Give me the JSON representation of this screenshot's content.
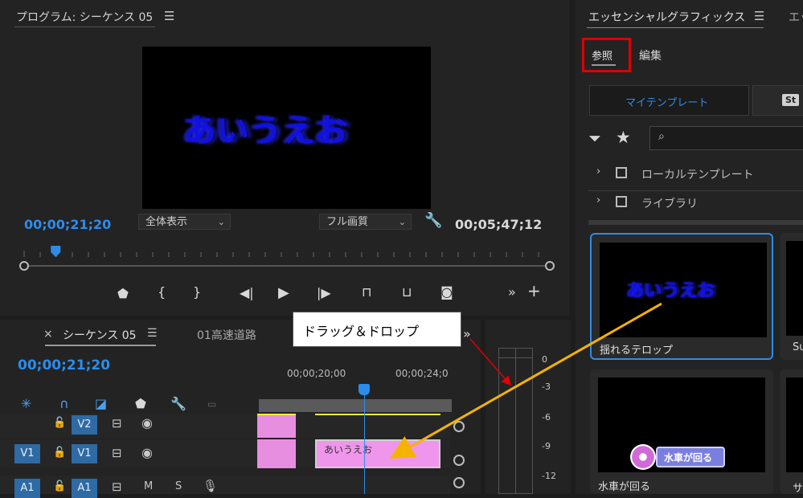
{
  "program_monitor": {
    "title": "プログラム: シーケンス 05",
    "preview_text": "あいうえお",
    "current_time": "00;00;21;20",
    "zoom_select": "全体表示",
    "quality_select": "フル画質",
    "duration": "00;05;47;12",
    "playhead_progress": 0.06
  },
  "timeline": {
    "close_x": "×",
    "tab_active": "シーケンス 05",
    "tab_other": "01高速道路",
    "current_time": "00;00;21;20",
    "ruler_labels": [
      "00;00;20;00",
      "00;00;24;0"
    ],
    "tracks": {
      "v2_target": "V2",
      "v1_source": "V1",
      "v1_target": "V1",
      "a1_source": "A1",
      "a1_target": "A1",
      "m": "M",
      "s": "S"
    },
    "clip_label": "あいうえお",
    "meter_labels": [
      "0",
      "-3",
      "-6",
      "-9",
      "-12"
    ]
  },
  "annotation": {
    "callout_text": "ドラッグ＆ドロップ"
  },
  "essential_graphics": {
    "title": "エッセンシャルグラフィックス",
    "title_cut": "エッセ",
    "tab_browse": "参照",
    "tab_edit": "編集",
    "my_templates_btn": "マイテンプレート",
    "stock_badge": "St",
    "folders": [
      "ローカルテンプレート",
      "ライブラリ"
    ],
    "templates": [
      {
        "name": "揺れるテロップ",
        "preview_text": "あいうえお"
      },
      {
        "name": "水車が回る",
        "preview_text": "水車が回る"
      }
    ],
    "partial_labels": [
      "Su",
      "サ"
    ]
  },
  "colors": {
    "accent_blue": "#2d8ceb",
    "preview_text_blue": "#1515e0",
    "clip_pink": "#e88ee0",
    "annotation_red": "#e00000",
    "arrow_orange": "#f5b300"
  }
}
